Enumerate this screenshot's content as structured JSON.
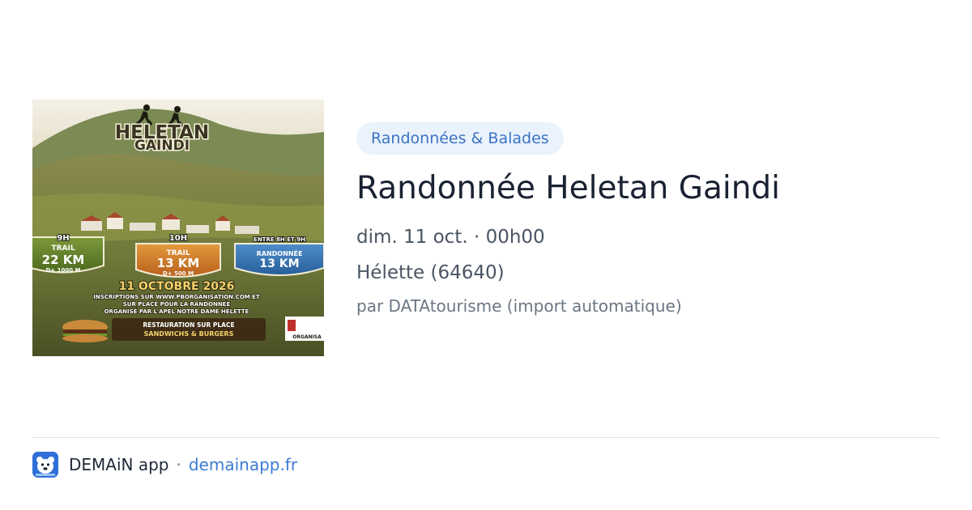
{
  "event": {
    "poster": {
      "title_line1": "HELETAN",
      "title_line2": "GAINDI",
      "badges": [
        {
          "time": "9H",
          "type": "TRAIL",
          "distance": "22 KM",
          "elevation": "D+ 1000 M"
        },
        {
          "time": "10H",
          "type": "TRAIL",
          "distance": "13 KM",
          "elevation": "D+ 500 M"
        },
        {
          "time": "ENTRE 8H ET 9H",
          "type": "RANDONNÉE",
          "distance": "13 KM",
          "elevation": ""
        }
      ],
      "date_line": "11 OCTOBRE 2026",
      "info_line1": "INSCRIPTIONS SUR WWW.PBORGANISATION.COM ET",
      "info_line2": "SUR PLACE POUR LA RANDONNÉE",
      "info_line3": "ORGANISÉ PAR L'APEL NOTRE DAME HÉLETTE",
      "food_line1": "RESTAURATION SUR PLACE",
      "food_line2": "SANDWICHS & BURGERS",
      "sponsor_text": "ORGANISA"
    },
    "category": "Randonnées & Balades",
    "title": "Randonnée Heletan Gaindi",
    "date": "dim. 11 oct. · 00h00",
    "location": "Hélette (64640)",
    "author": "par DATAtourisme (import automatique)"
  },
  "footer": {
    "app_name": "DEMAiN app",
    "separator": "·",
    "link": "demainapp.fr",
    "logo_icon": "bear-face-icon"
  },
  "colors": {
    "pill_bg": "#eaf2fc",
    "pill_text": "#3b73c4",
    "link": "#3b7bd6",
    "logo_bg": "#2f6fd8"
  }
}
